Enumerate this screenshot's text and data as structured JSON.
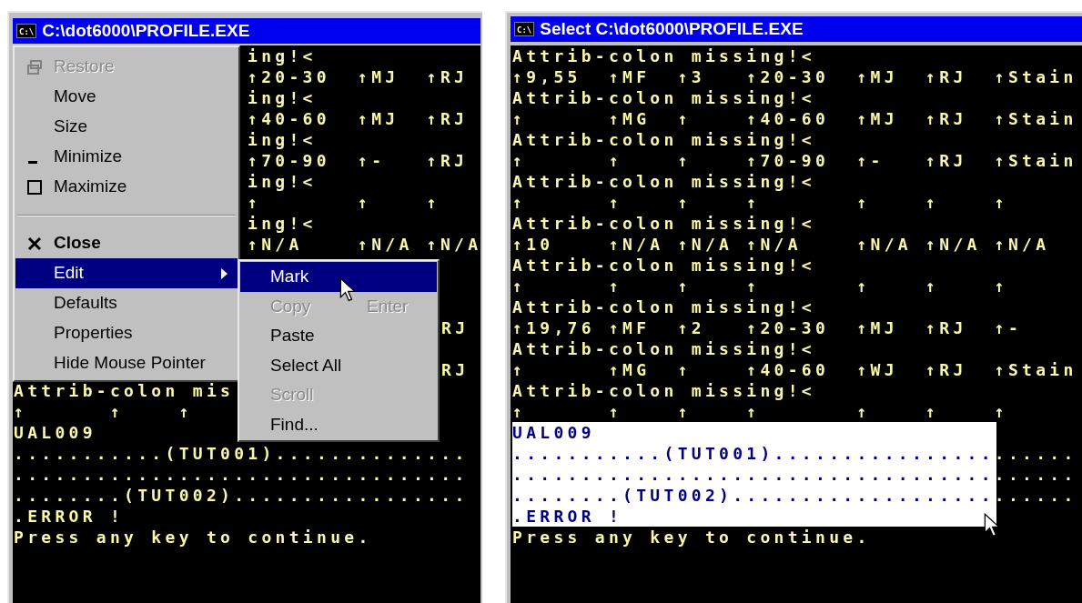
{
  "windows": [
    {
      "title": "C:\\dot6000\\PROFILE.EXE",
      "icon_text": "C:\\",
      "console": {
        "lines": [
          {
            "text": "ing!<",
            "kind": "beside_menu"
          },
          {
            "text": "↑20-30  ↑MJ  ↑RJ",
            "kind": "beside_menu"
          },
          {
            "text": "ing!<",
            "kind": "beside_menu"
          },
          {
            "text": "↑40-60  ↑MJ  ↑RJ",
            "kind": "beside_menu"
          },
          {
            "text": "ing!<",
            "kind": "beside_menu"
          },
          {
            "text": "↑70-90  ↑-   ↑RJ",
            "kind": "beside_menu"
          },
          {
            "text": "ing!<",
            "kind": "beside_menu"
          },
          {
            "text": "↑       ↑    ↑",
            "kind": "beside_menu"
          },
          {
            "text": "ing!<",
            "kind": "beside_menu"
          },
          {
            "text": "↑N/A    ↑N/A ↑N/A",
            "kind": "beside_menu"
          },
          {
            "text": "RJ",
            "kind": "beside_submenu"
          },
          {
            "text": "RJ",
            "kind": "beside_submenu"
          },
          {
            "text": "Attrib-colon mis",
            "kind": "full"
          },
          {
            "text": "↑      ↑    ↑",
            "kind": "full"
          },
          {
            "text": "UAL009",
            "kind": "full"
          },
          {
            "text": "...........(TUT001)..............",
            "kind": "full"
          },
          {
            "text": ".................................",
            "kind": "full"
          },
          {
            "text": "........(TUT002).................",
            "kind": "full"
          },
          {
            "text": ".ERROR !",
            "kind": "full"
          },
          {
            "text": "Press any key to continue.",
            "kind": "full"
          }
        ]
      },
      "system_menu": {
        "items": [
          {
            "label": "Restore",
            "kind": "restore",
            "disabled": true,
            "selected": false
          },
          {
            "label": "Move",
            "kind": "plain",
            "disabled": false,
            "selected": false
          },
          {
            "label": "Size",
            "kind": "plain",
            "disabled": false,
            "selected": false
          },
          {
            "label": "Minimize",
            "kind": "minimize",
            "disabled": false,
            "selected": false
          },
          {
            "label": "Maximize",
            "kind": "maximize",
            "disabled": false,
            "selected": false
          },
          {
            "label": "Close",
            "kind": "close",
            "disabled": false,
            "selected": false
          },
          {
            "label": "Edit",
            "kind": "submenu",
            "disabled": false,
            "selected": true
          },
          {
            "label": "Defaults",
            "kind": "plain",
            "disabled": false,
            "selected": false
          },
          {
            "label": "Properties",
            "kind": "plain",
            "disabled": false,
            "selected": false
          },
          {
            "label": "Hide Mouse Pointer",
            "kind": "plain",
            "disabled": false,
            "selected": false
          }
        ]
      },
      "submenu": {
        "items": [
          {
            "label": "Mark",
            "disabled": false,
            "selected": true
          },
          {
            "label": "Copy",
            "shortcut": "Enter",
            "disabled": true,
            "selected": false
          },
          {
            "label": "Paste",
            "disabled": false,
            "selected": false
          },
          {
            "label": "Select All",
            "disabled": false,
            "selected": false
          },
          {
            "label": "Scroll",
            "disabled": true,
            "selected": false
          },
          {
            "label": "Find...",
            "disabled": false,
            "selected": false
          }
        ]
      }
    },
    {
      "title": "Select C:\\dot6000\\PROFILE.EXE",
      "icon_text": "C:\\",
      "console": {
        "lines": [
          {
            "text": "Attrib-colon missing!<",
            "selected": false
          },
          {
            "text": "↑9,55  ↑MF  ↑3   ↑20-30  ↑MJ  ↑RJ  ↑Stain",
            "selected": false
          },
          {
            "text": "Attrib-colon missing!<",
            "selected": false
          },
          {
            "text": "↑      ↑MG  ↑    ↑40-60  ↑MJ  ↑RJ  ↑Stain",
            "selected": false
          },
          {
            "text": "Attrib-colon missing!<",
            "selected": false
          },
          {
            "text": "↑      ↑    ↑    ↑70-90  ↑-   ↑RJ  ↑Stain",
            "selected": false
          },
          {
            "text": "Attrib-colon missing!<",
            "selected": false
          },
          {
            "text": "↑      ↑    ↑    ↑       ↑    ↑    ↑",
            "selected": false
          },
          {
            "text": "Attrib-colon missing!<",
            "selected": false
          },
          {
            "text": "↑10    ↑N/A ↑N/A ↑N/A    ↑N/A ↑N/A ↑N/A",
            "selected": false
          },
          {
            "text": "Attrib-colon missing!<",
            "selected": false
          },
          {
            "text": "↑      ↑    ↑    ↑       ↑    ↑    ↑",
            "selected": false
          },
          {
            "text": "Attrib-colon missing!<",
            "selected": false
          },
          {
            "text": "↑19,76 ↑MF  ↑2   ↑20-30  ↑MJ  ↑RJ  ↑-",
            "selected": false
          },
          {
            "text": "Attrib-colon missing!<",
            "selected": false
          },
          {
            "text": "↑      ↑MG  ↑    ↑40-60  ↑WJ  ↑RJ  ↑Stain",
            "selected": false
          },
          {
            "text": "Attrib-colon missing!<",
            "selected": false
          },
          {
            "text": "↑      ↑    ↑    ↑       ↑    ↑    ↑",
            "selected": false
          },
          {
            "text": "UAL009",
            "selected": true
          },
          {
            "text": "...........(TUT001)......................",
            "selected": true
          },
          {
            "text": ".........................................",
            "selected": true
          },
          {
            "text": "........(TUT002).........................",
            "selected": true
          },
          {
            "text": ".ERROR !",
            "selected": true
          },
          {
            "text": "Press any key to continue.",
            "selected": false
          }
        ]
      }
    }
  ]
}
